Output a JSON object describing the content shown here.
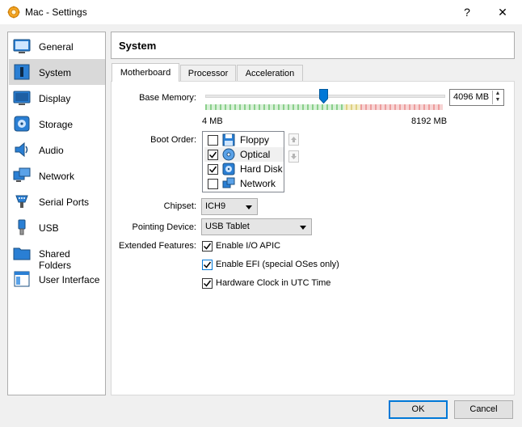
{
  "window": {
    "title": "Mac - Settings",
    "help": "?",
    "close": "✕"
  },
  "sidebar": {
    "items": [
      {
        "label": "General",
        "icon": "general-icon"
      },
      {
        "label": "System",
        "icon": "system-icon"
      },
      {
        "label": "Display",
        "icon": "display-icon"
      },
      {
        "label": "Storage",
        "icon": "storage-icon"
      },
      {
        "label": "Audio",
        "icon": "audio-icon"
      },
      {
        "label": "Network",
        "icon": "network-icon"
      },
      {
        "label": "Serial Ports",
        "icon": "serial-ports-icon"
      },
      {
        "label": "USB",
        "icon": "usb-icon"
      },
      {
        "label": "Shared Folders",
        "icon": "shared-folders-icon"
      },
      {
        "label": "User Interface",
        "icon": "user-interface-icon"
      }
    ],
    "selected": "System"
  },
  "page": {
    "title": "System"
  },
  "tabs": [
    {
      "label": "Motherboard",
      "active": true
    },
    {
      "label": "Processor",
      "active": false
    },
    {
      "label": "Acceleration",
      "active": false
    }
  ],
  "motherboard": {
    "base_memory": {
      "label": "Base Memory:",
      "value": "4096 MB",
      "value_mb": 4096,
      "min_label": "4 MB",
      "max_label": "8192 MB",
      "min_mb": 4,
      "max_mb": 8192
    },
    "boot_order": {
      "label": "Boot Order:",
      "items": [
        {
          "label": "Floppy",
          "checked": false,
          "icon": "floppy-icon"
        },
        {
          "label": "Optical",
          "checked": true,
          "icon": "optical-icon",
          "selected": true
        },
        {
          "label": "Hard Disk",
          "checked": true,
          "icon": "hard-disk-icon"
        },
        {
          "label": "Network",
          "checked": false,
          "icon": "network-boot-icon"
        }
      ]
    },
    "chipset": {
      "label": "Chipset:",
      "value": "ICH9"
    },
    "pointing_device": {
      "label": "Pointing Device:",
      "value": "USB Tablet"
    },
    "extended_features": {
      "label": "Extended Features:",
      "items": [
        {
          "label": "Enable I/O APIC",
          "checked": true
        },
        {
          "label": "Enable EFI (special OSes only)",
          "checked": true
        },
        {
          "label": "Hardware Clock in UTC Time",
          "checked": true
        }
      ]
    }
  },
  "buttons": {
    "ok": "OK",
    "cancel": "Cancel"
  },
  "colors": {
    "accent": "#0078d7",
    "slider_green": "#8fd18f",
    "slider_yellow": "#e6d77a",
    "slider_red": "#ef9a9a"
  }
}
